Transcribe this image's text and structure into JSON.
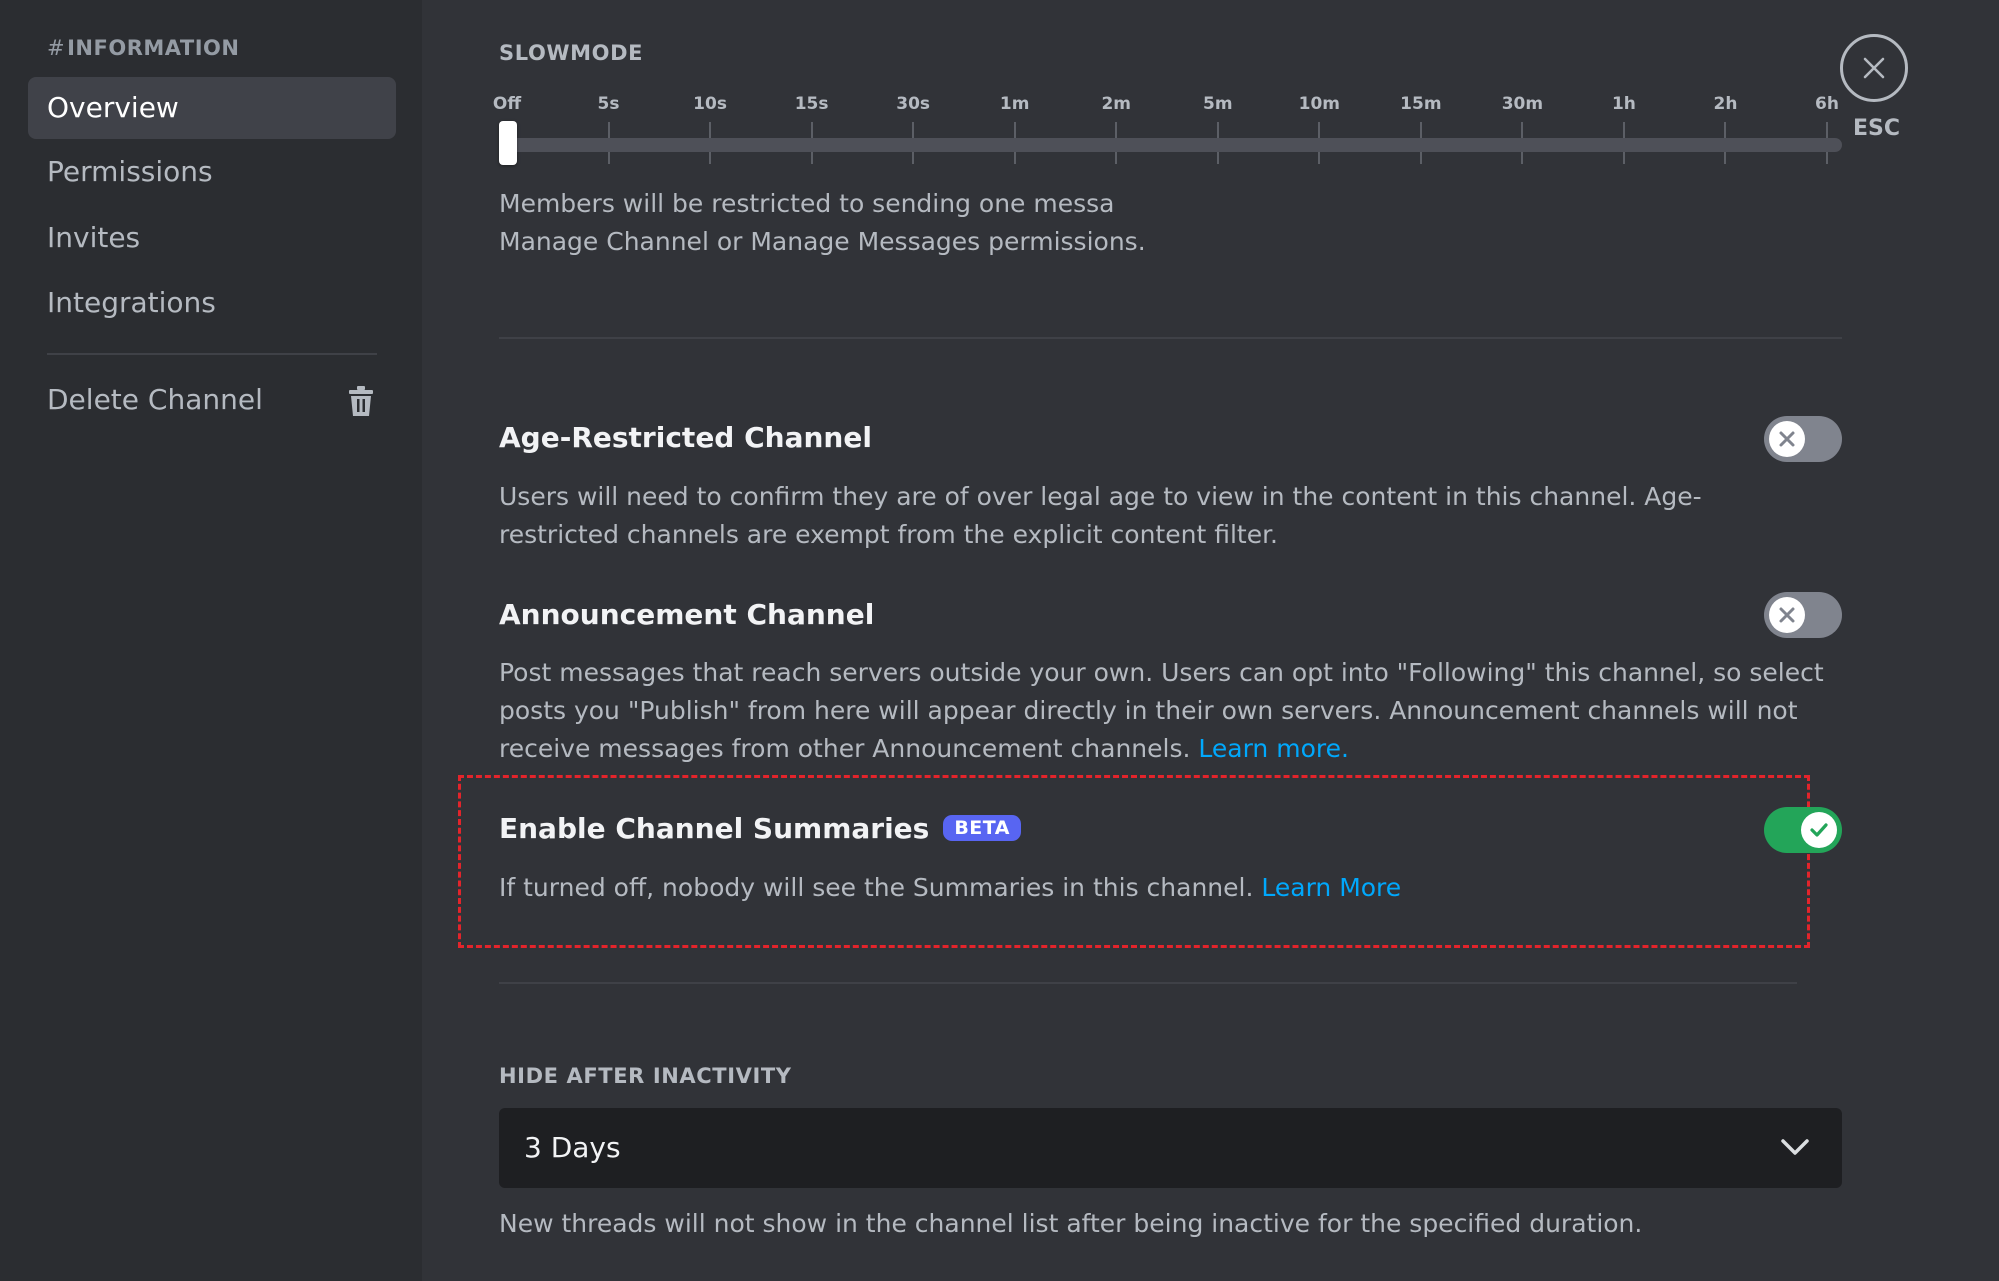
{
  "sidebar": {
    "header_hash": "#",
    "header": "INFORMATION",
    "items": [
      {
        "label": "Overview",
        "selected": true
      },
      {
        "label": "Permissions"
      },
      {
        "label": "Invites"
      },
      {
        "label": "Integrations"
      }
    ],
    "delete_label": "Delete Channel",
    "delete_icon": "trash-icon"
  },
  "slowmode": {
    "title": "SLOWMODE",
    "ticks": [
      "Off",
      "5s",
      "10s",
      "15s",
      "30s",
      "1m",
      "2m",
      "5m",
      "10m",
      "15m",
      "30m",
      "1h",
      "2h",
      "6h"
    ],
    "selected": "Off",
    "description_line1": "Members will be restricted to sending one messa",
    "description_line2": "Manage Channel or Manage Messages permissions."
  },
  "age_restricted": {
    "title": "Age-Restricted Channel",
    "enabled": false,
    "description": "Users will need to confirm they are of over legal age to view in the content in this channel. Age-restricted channels are exempt from the explicit content filter."
  },
  "announcement": {
    "title": "Announcement Channel",
    "enabled": false,
    "description": "Post messages that reach servers outside your own. Users can opt into \"Following\" this channel, so select posts you \"Publish\" from here will appear directly in their own servers. Announcement channels will not receive messages from other Announcement channels.",
    "link": "Learn more."
  },
  "summaries": {
    "title": "Enable Channel Summaries",
    "badge": "BETA",
    "enabled": true,
    "description": "If turned off, nobody will see the Summaries in this channel.",
    "link": "Learn More"
  },
  "hide_after_inactivity": {
    "title": "HIDE AFTER INACTIVITY",
    "value": "3 Days",
    "description": "New threads will not show in the channel list after being inactive for the specified duration."
  },
  "close": {
    "label": "ESC",
    "icon": "close-icon"
  },
  "colors": {
    "accent_link": "#00a8fc",
    "toggle_on": "#23a559",
    "toggle_off": "#80848e",
    "beta_badge": "#5865f2",
    "highlight_border": "#e3242b"
  }
}
